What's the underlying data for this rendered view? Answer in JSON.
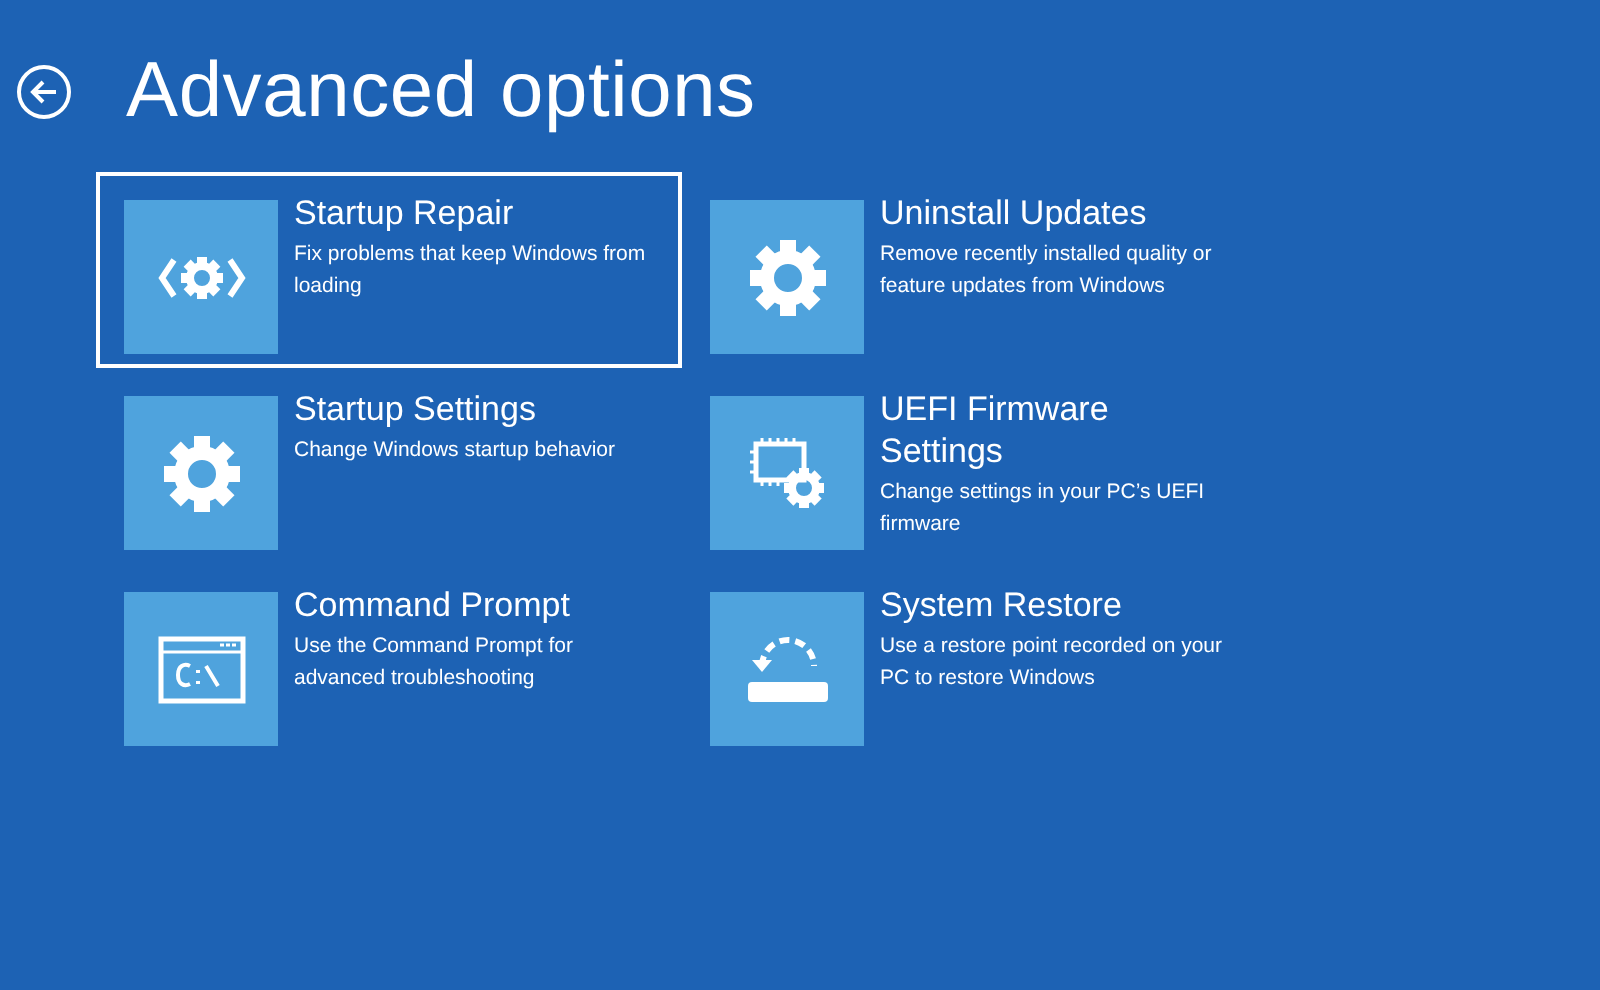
{
  "title": "Advanced options",
  "options": [
    {
      "kind": "repair",
      "title": "Startup Repair",
      "description": "Fix problems that keep Windows from loading",
      "selected": true
    },
    {
      "kind": "gear",
      "title": "Uninstall Updates",
      "description": "Remove recently installed quality or feature updates from Windows",
      "selected": false
    },
    {
      "kind": "gear",
      "title": "Startup Settings",
      "description": "Change Windows startup behavior",
      "selected": false
    },
    {
      "kind": "firmware",
      "title": "UEFI Firmware Settings",
      "description": "Change settings in your PC’s UEFI firmware",
      "selected": false
    },
    {
      "kind": "terminal",
      "title": "Command Prompt",
      "description": "Use the Command Prompt for advanced troubleshooting",
      "selected": false
    },
    {
      "kind": "restore",
      "title": "System Restore",
      "description": "Use a restore point recorded on your PC to restore Windows",
      "selected": false
    }
  ]
}
